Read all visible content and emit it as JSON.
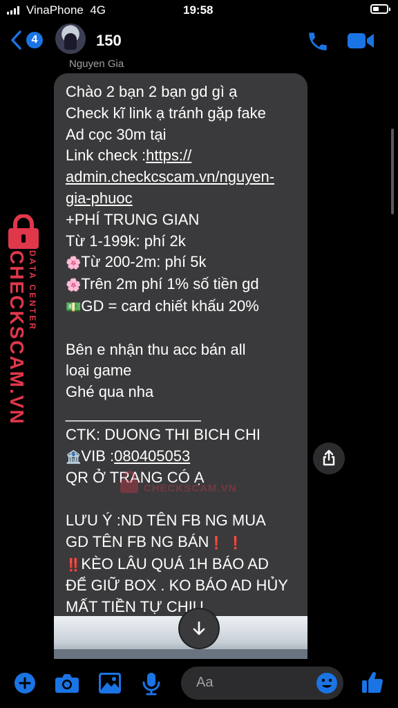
{
  "status_bar": {
    "carrier": "VinaPhone",
    "network": "4G",
    "time": "19:58"
  },
  "header": {
    "back_badge": "4",
    "chat_name": "150"
  },
  "message": {
    "sender": "Nguyen Gia",
    "lines": [
      {
        "text": "Chào 2 bạn 2 bạn gd gì ạ"
      },
      {
        "text": "Check kĩ link ạ tránh gặp fake"
      },
      {
        "text": "Ad cọc 30m tại"
      },
      {
        "text": "Link check :",
        "link": "https://"
      },
      {
        "link": "admin.checkcscam.vn/nguyen-"
      },
      {
        "link": "gia-phuoc"
      },
      {
        "text": "+PHÍ TRUNG GIAN"
      },
      {
        "text": "Từ 1-199k: phí 2k"
      },
      {
        "emoji": "🌸",
        "text": "Từ 200-2m: phí 5k"
      },
      {
        "emoji": "🌸",
        "text": "Trên 2m phí 1% số tiền gd"
      },
      {
        "emoji": "💵",
        "text": "GD = card chiết khấu 20%"
      },
      {
        "text": ""
      },
      {
        "text": "Bên e nhận thu acc bán all"
      },
      {
        "text": "loại game"
      },
      {
        "text": "Ghé qua nha"
      },
      {
        "text": "________________"
      },
      {
        "text": "CTK: DUONG THI BICH CHI"
      },
      {
        "emoji": "🏦",
        "text": "VIB :",
        "link": "080405053"
      },
      {
        "text": "QR Ở TRANG CÓ Ạ"
      },
      {
        "text": ""
      },
      {
        "text": "LƯU Ý :ND TÊN FB NG MUA"
      },
      {
        "text": "GD TÊN FB NG BÁN",
        "suffix": "❗ ❗"
      },
      {
        "emoji": "‼️",
        "text": "KÈO LÂU QUÁ 1H BÁO AD"
      },
      {
        "text": "ĐỂ GIỮ BOX . KO BÁO AD HỦY"
      },
      {
        "text": "MẤT TIỀN TỰ CHỊU"
      }
    ]
  },
  "watermark": {
    "brand": "CHECKSCAM.VN",
    "sub": "DATA CENTER",
    "center": "CHECKSCAM.VN"
  },
  "composer": {
    "placeholder": "Aa"
  },
  "icons": [
    "back-chevron-icon",
    "phone-icon",
    "video-camera-icon",
    "share-icon",
    "arrow-down-icon",
    "plus-icon",
    "camera-icon",
    "image-icon",
    "microphone-icon",
    "emoji-icon",
    "thumbs-up-icon",
    "lock-icon"
  ],
  "colors": {
    "accent": "#1b74e4",
    "bubble": "#3a3a3c",
    "watermark": "#e0374b",
    "background": "#000000"
  }
}
